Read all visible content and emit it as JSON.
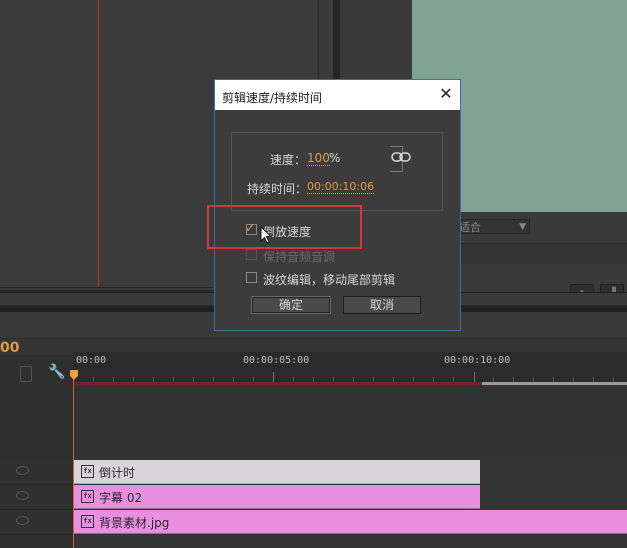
{
  "timeline": {
    "timecode": "00",
    "ruler_labels": [
      "00:00",
      "00:00:05:00",
      "00:00:10:00"
    ],
    "clips": [
      {
        "name": "倒计时",
        "fx": "fx"
      },
      {
        "name": "字幕 02",
        "fx": "fx"
      },
      {
        "name": "背景素材.jpg",
        "fx": "fx"
      }
    ]
  },
  "program_monitor": {
    "fit_dropdown": "适合"
  },
  "dialog": {
    "title": "剪辑速度/持续时间",
    "close_symbol": "✕",
    "speed_label": "速度：",
    "speed_value": "100",
    "speed_unit": "%",
    "duration_label": "持续时间：",
    "duration_value": "00:00:10:06",
    "reverse_speed_label": "倒放速度",
    "maintain_pitch_label": "保持音频音调",
    "ripple_edit_label": "波纹编辑，移动尾部剪辑",
    "ok_label": "确定",
    "cancel_label": "取消",
    "reverse_speed_checked": true,
    "maintain_pitch_checked": false,
    "ripple_edit_checked": false
  },
  "colors": {
    "accent_orange": "#e09a3c",
    "highlight_red": "#d23a3a",
    "clip_pink": "#e98fe2",
    "clip_gray": "#d8d5d8",
    "program_video": "#80a294"
  },
  "icons": [
    "link-chain-icon",
    "close-icon",
    "wrench-icon",
    "eye-icon",
    "fx-icon",
    "mouse-cursor-icon",
    "playhead-icon"
  ]
}
